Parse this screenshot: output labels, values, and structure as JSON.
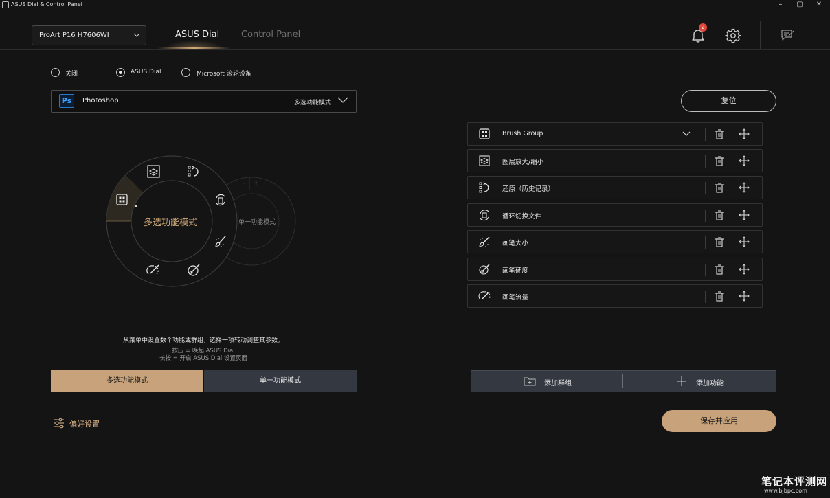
{
  "window": {
    "title": "ASUS Dial & Control Panel",
    "controls": [
      "–",
      "▢",
      "✕"
    ]
  },
  "header": {
    "device": "ProArt P16 H7606WI",
    "tabs": [
      {
        "label": "ASUS Dial",
        "active": true
      },
      {
        "label": "Control Panel",
        "active": false
      }
    ],
    "notification_count": "2",
    "icons": [
      "bell-icon",
      "gear-icon",
      "feedback-icon"
    ]
  },
  "mode_radios": [
    {
      "label": "关闭",
      "checked": false
    },
    {
      "label": "ASUS Dial",
      "checked": true
    },
    {
      "label": "Microsoft 滚轮设备",
      "checked": false
    }
  ],
  "app_selector": {
    "icon_text": "Ps",
    "app": "Photoshop",
    "mode": "多选功能模式"
  },
  "dial": {
    "center_label": "多选功能模式",
    "ghost_label": "单一功能模式",
    "ghost_minus": "-",
    "ghost_plus": "+"
  },
  "hints": {
    "line1": "从菜单中设置数个功能或群组，选择一项转动调整其参数。",
    "line2": "按压 = 唤起 ASUS Dial",
    "line3": "长按 = 开启 ASUS Dial 设置页面"
  },
  "mode_buttons": {
    "multi": "多选功能模式",
    "single": "单一功能模式"
  },
  "preferences": {
    "label": "偏好设置"
  },
  "reset": {
    "label": "复位"
  },
  "functions": [
    {
      "label": "Brush Group",
      "icon": "grid-icon",
      "expandable": true
    },
    {
      "label": "图层放大/缩小",
      "icon": "layer-zoom-icon"
    },
    {
      "label": "还原（历史记录）",
      "icon": "history-undo-icon"
    },
    {
      "label": "循环切换文件",
      "icon": "cycle-files-icon"
    },
    {
      "label": "画笔大小",
      "icon": "brush-size-icon"
    },
    {
      "label": "画笔硬度",
      "icon": "brush-hardness-icon"
    },
    {
      "label": "画笔流量",
      "icon": "brush-flow-icon"
    }
  ],
  "add_bar": {
    "group": "添加群组",
    "function": "添加功能"
  },
  "save": {
    "label": "保存并应用"
  },
  "watermark": {
    "line1": "笔记本评测网",
    "line2": "www.bjbpc.com"
  },
  "colors": {
    "accent": "#c8a27a",
    "background": "#141414",
    "badge": "#e0473b"
  }
}
